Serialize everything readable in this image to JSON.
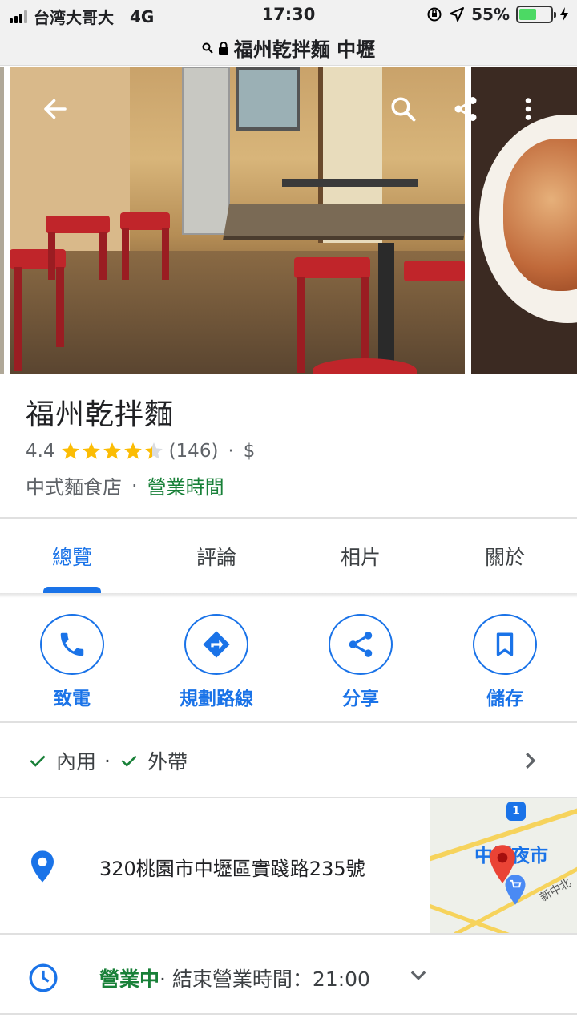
{
  "status_bar": {
    "carrier": "台湾大哥大",
    "network": "4G",
    "time": "17:30",
    "battery": "55%",
    "battery_level": 0.55
  },
  "url_bar": {
    "url": "福州乾拌麵 中壢"
  },
  "header": {
    "back_icon": "arrow-left-icon",
    "search_icon": "search-icon",
    "share_icon": "share-icon",
    "more_icon": "more-vert-icon"
  },
  "place": {
    "name": "福州乾拌麵",
    "rating": "4.4",
    "rating_value": 4.4,
    "reviews_count": "(146)",
    "price": "$",
    "category": "中式麵食店",
    "hours_link": "營業時間"
  },
  "tabs": [
    {
      "label": "總覽",
      "active": true
    },
    {
      "label": "評論",
      "active": false
    },
    {
      "label": "相片",
      "active": false
    },
    {
      "label": "關於",
      "active": false
    }
  ],
  "actions": [
    {
      "label": "致電",
      "icon": "phone-icon"
    },
    {
      "label": "規劃路線",
      "icon": "directions-icon"
    },
    {
      "label": "分享",
      "icon": "share-icon"
    },
    {
      "label": "儲存",
      "icon": "bookmark-icon"
    }
  ],
  "services": {
    "dine_in": "內用",
    "separator": "·",
    "takeout": "外帶"
  },
  "address": {
    "text": "320桃園市中壢區實踐路235號",
    "map_label": "中壢夜市",
    "map_road_label": "新中北",
    "map_route_number": "1"
  },
  "hours": {
    "status": "營業中",
    "detail": "· 結束營業時間：21:00"
  },
  "colors": {
    "accent": "#1a73e8",
    "open_green": "#188038",
    "star": "#fbbc04",
    "map_pin": "#ea4335"
  }
}
